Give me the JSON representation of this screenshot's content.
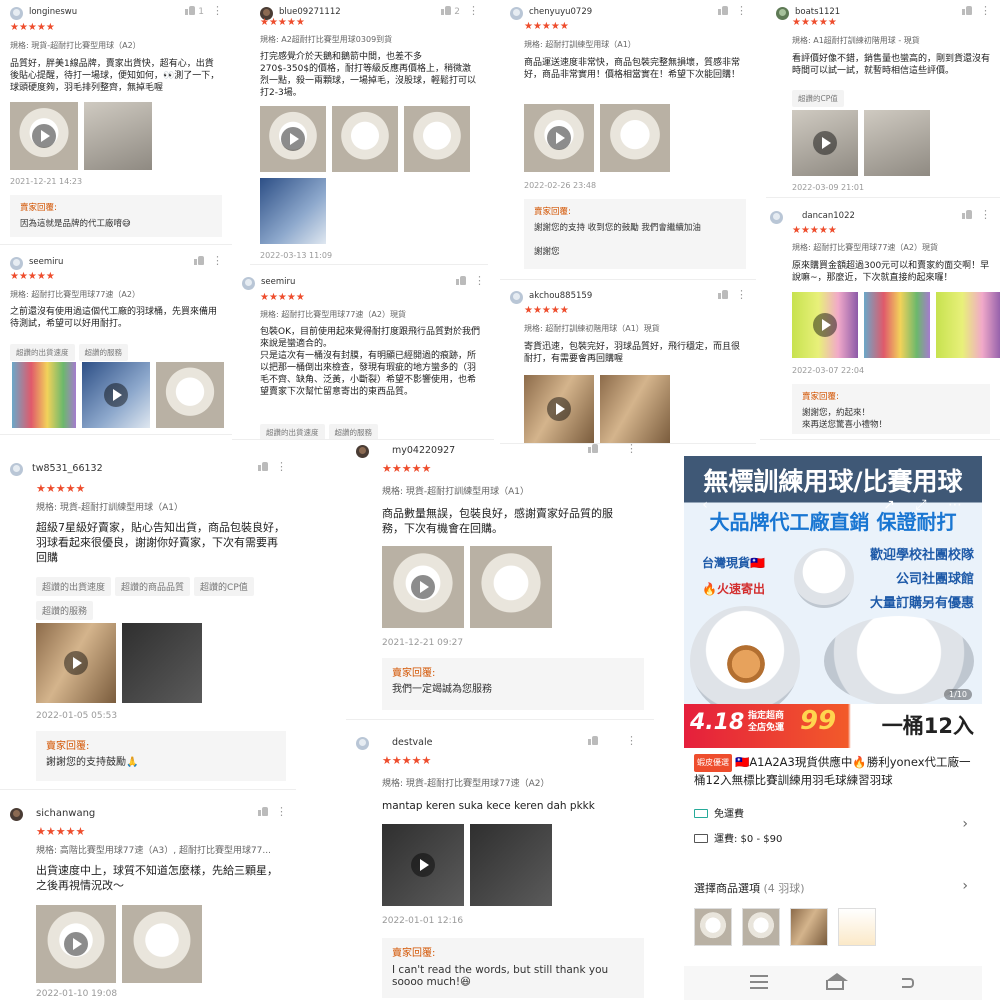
{
  "reviews": [
    {
      "user": "longineswu",
      "likes": "1",
      "stars": "★★★★★",
      "spec": "規格: 現貨-超耐打比賽型用球（A2）",
      "text": "品質好，胖美1線品牌，賣家出貨快，超有心，出貨後貼心提醒，待打一場球，便知如何，👀測了一下，球頭硬度夠，羽毛排列整齊，無掉毛喔",
      "date": "2021-12-21 14:23",
      "reply_title": "賣家回覆:",
      "reply": "因為這就是品牌的代工廠唷😅"
    },
    {
      "user": "blue09271112",
      "likes": "2",
      "stars": "★★★★★",
      "spec": "規格: A2超耐打比賽型用球0309到貨",
      "text": "打完感覺介於天鵝和鵝箭中間，也差不多270$-350$的價格，耐打等級反應再價格上，稍微激烈一點，殺一兩顆球，一場掉毛，沒股球，輕鬆打可以打2-3場。",
      "date": "2022-03-13 11:09"
    },
    {
      "user": "chenyuyu0729",
      "likes": "",
      "stars": "★★★★★",
      "spec": "規格: 超耐打訓練型用球（A1）",
      "text": "商品運送速度非常快，商品包裝完整無損壞，質感非常好，商品非常實用！價格相當實在！希望下次能回購！",
      "date": "2022-02-26 23:48",
      "reply_title": "賣家回覆:",
      "reply": "謝謝您的支持 收到您的鼓勵 我們會繼續加油\n\n謝謝您"
    },
    {
      "user": "boats1121",
      "likes": "",
      "stars": "★★★★★",
      "spec": "規格: A1超耐打訓練初階用球 - 現貨",
      "text": "看評價好像不錯，銷售量也蠻高的，剛到貨還沒有時間可以試一試，就暫時相信這些評價。",
      "tags": [
        "超讚的CP值"
      ],
      "date": "2022-03-09 21:01"
    },
    {
      "user": "seemiru",
      "likes": "",
      "stars": "★★★★★",
      "spec": "規格: 超耐打比賽型用球77速（A2）",
      "text": "之前還沒有使用過這個代工廠的羽球桶，先買來備用待測試，希望可以好用耐打。",
      "tags": [
        "超讚的出貨速度",
        "超讚的服務"
      ]
    },
    {
      "user": "seemiru",
      "likes": "",
      "stars": "★★★★★",
      "spec": "規格: 超耐打比賽型用球77速（A2）現貨",
      "text": "包裝OK，目前使用起來覺得耐打度跟飛行品質對於我們來說是蠻適合的。\n只是這次有一桶沒有封膜，有明顯已經開過的痕跡，所以把那一桶倒出來檢查，發現有瑕疵的地方蠻多的（羽毛不齊、缺角、泛黃，小斷裂）希望不影響使用，也希望賣家下次幫忙留意寄出的東西品質。",
      "tags": [
        "超讚的出貨速度",
        "超讚的服務"
      ]
    },
    {
      "user": "akchou885159",
      "likes": "",
      "stars": "★★★★★",
      "spec": "規格: 超耐打訓練初階用球（A1）現貨",
      "text": "寄貨迅速，包裝完好，羽球品質好，飛行穩定，而且很耐打，有需要會再回購喔"
    },
    {
      "user": "dancan1022",
      "likes": "",
      "stars": "★★★★★",
      "spec": "規格: 超耐打比賽型用球77速（A2）現貨",
      "text": "原來購買金額超過300元可以和賣家約面交啊！早說嘛~，那麼近，下次就直接約起來囉！",
      "date": "2022-03-07 22:04",
      "reply_title": "賣家回覆:",
      "reply": "謝謝您，約起來！\n來再送您驚喜小禮物！"
    },
    {
      "user": "tw8531_66132",
      "likes": "",
      "stars": "★★★★★",
      "spec": "規格: 現貨-超耐打訓練型用球（A1）",
      "text": "超級7星級好賣家，貼心告知出貨，商品包裝良好，羽球看起來很優良，謝謝你好賣家，下次有需要再回購",
      "tags": [
        "超讚的出貨速度",
        "超讚的商品品質",
        "超讚的CP值",
        "超讚的服務"
      ],
      "date": "2022-01-05 05:53",
      "reply_title": "賣家回覆:",
      "reply": "謝謝您的支持鼓勵🙏"
    },
    {
      "user": "my04220927",
      "likes": "",
      "stars": "★★★★★",
      "spec": "規格: 現貨-超耐打訓練型用球（A1）",
      "text": "商品數量無誤，包裝良好，感謝賣家好品質的服務，下次有機會在回購。",
      "date": "2021-12-21 09:27",
      "reply_title": "賣家回覆:",
      "reply": "我們一定竭誠為您服務"
    },
    {
      "user": "sichanwang",
      "likes": "",
      "stars": "★★★★★",
      "spec": "規格: 高階比賽型用球77速（A3）, 超耐打比賽型用球77...",
      "text": "出貨速度中上，球質不知道怎麼樣，先給三顆星，之後再視情況改～",
      "date": "2022-01-10 19:08"
    },
    {
      "user": "destvale",
      "likes": "",
      "stars": "★★★★★",
      "spec": "規格: 現貨-超耐打比賽型用球77速（A2）",
      "text": "mantap keren suka kece keren dah pkkk",
      "date": "2022-01-01 12:16",
      "reply_title": "賣家回覆:",
      "reply": "I can't read the words, but still thank you\nsoooo much!😆"
    }
  ],
  "product": {
    "banner_line1": "無標訓練用球/比賽用球",
    "banner_line2": "大品牌代工廠直銷 保證耐打",
    "banner_tw": "台灣現貨🇹🇼",
    "banner_fast": "🔥火速寄出",
    "banner_right": "歡迎學校社團校隊\n公司社團球館\n大量訂購另有優惠",
    "promo_date": "4.18",
    "promo_ship": "指定超商\n全店免運",
    "promo_99": "99",
    "promo_bucket": "一桶12入",
    "pager": "1/10",
    "badge": "蝦皮優選",
    "title": "🇹🇼A1A2A3現貨供應中🔥勝利yonex代工廠一桶12入無標比賽訓練用羽毛球練習羽球",
    "free_ship": "免運費",
    "ship_fee": "運費: $0 - $90",
    "options_label": "選擇商品選項",
    "options_count": "(4 羽球)"
  }
}
